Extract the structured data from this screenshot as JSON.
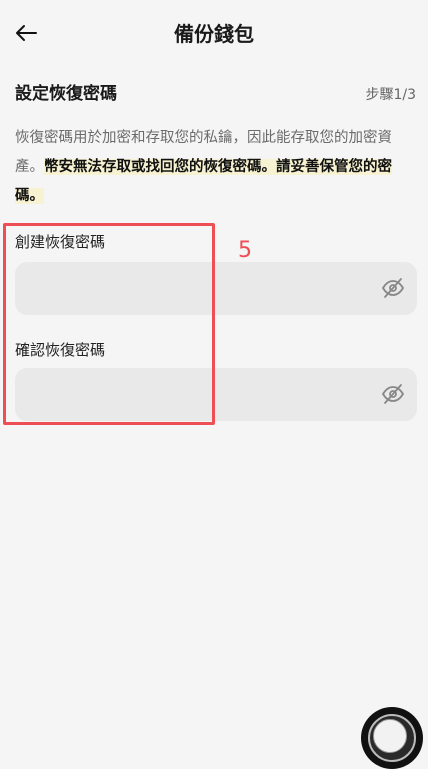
{
  "header": {
    "title": "備份錢包",
    "back_icon": "arrow-left-icon"
  },
  "section": {
    "title": "設定恢復密碼",
    "step": "步驟1/3"
  },
  "description": {
    "normal": "恢復密碼用於加密和存取您的私鑰，因此能存取您的加密資產。",
    "warning": "幣安無法存取或找回您的恢復密碼。請妥善保管您的密碼。"
  },
  "fields": {
    "create": {
      "label": "創建恢復密碼",
      "value": "",
      "toggle_icon": "eye-off-icon"
    },
    "confirm": {
      "label": "確認恢復密碼",
      "value": "",
      "toggle_icon": "eye-off-icon"
    }
  },
  "annotation": {
    "number": "5",
    "color": "#ee4e55"
  },
  "colors": {
    "background": "#f5f5f5",
    "input_bg": "#e9e9e9",
    "warning_highlight": "#f7f3d2"
  }
}
